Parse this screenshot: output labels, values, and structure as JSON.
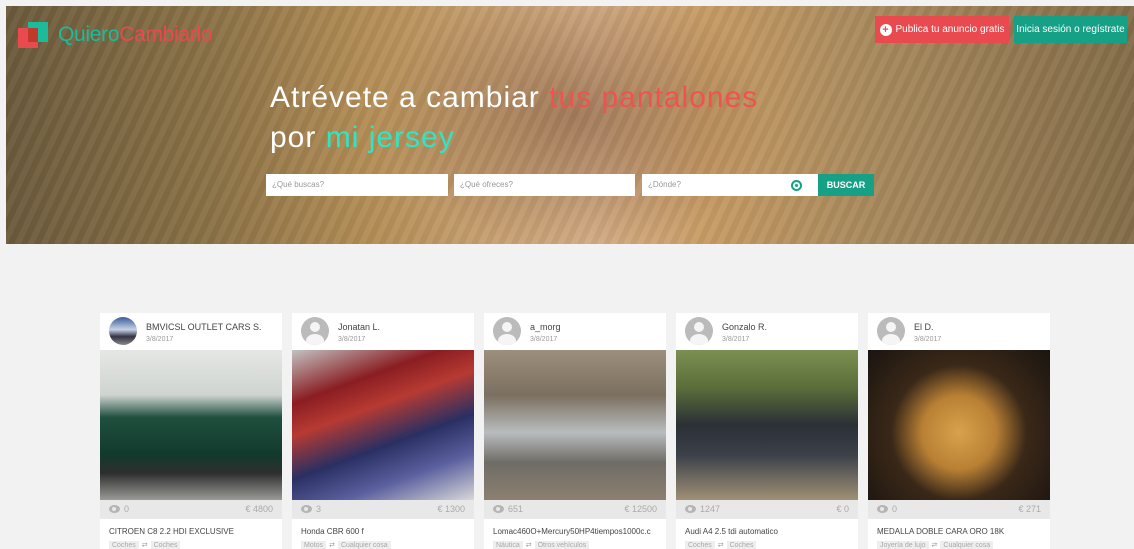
{
  "header": {
    "logo_part1": "Quiero",
    "logo_part2": "Cambiarlo",
    "publish_label": "Publica tu anuncio gratis",
    "login_label": "Inicia sesión o regístrate"
  },
  "hero": {
    "line1_prefix": "Atrévete a cambiar ",
    "line1_highlight": "tus pantalones",
    "line2_prefix": "por ",
    "line2_highlight": "mi jersey"
  },
  "search": {
    "what_placeholder": "¿Qué buscas?",
    "offer_placeholder": "¿Qué ofreces?",
    "where_placeholder": "¿Dónde?",
    "button_label": "BUSCAR"
  },
  "cards": [
    {
      "user": "BMVICSL OUTLET CARS S.",
      "date": "3/8/2017",
      "views": "0",
      "price": "€ 4800",
      "title": "CITROEN C8 2.2 HDI EXCLUSIVE",
      "tag_from": "Coches",
      "tag_to": "Coches"
    },
    {
      "user": "Jonatan L.",
      "date": "3/8/2017",
      "views": "3",
      "price": "€ 1300",
      "title": "Honda CBR 600 f",
      "tag_from": "Motos",
      "tag_to": "Cualquier cosa"
    },
    {
      "user": "a_morg",
      "date": "3/8/2017",
      "views": "651",
      "price": "€ 12500",
      "title": "Lomac460O+Mercury50HP4tiempos1000c.c",
      "tag_from": "Náutica",
      "tag_to": "Otros vehículos"
    },
    {
      "user": "Gonzalo R.",
      "date": "3/8/2017",
      "views": "1247",
      "price": "€ 0",
      "title": "Audi A4 2.5 tdi automatico",
      "tag_from": "Coches",
      "tag_to": "Coches"
    },
    {
      "user": "El D.",
      "date": "3/8/2017",
      "views": "0",
      "price": "€ 271",
      "title": "MEDALLA DOBLE CARA ORO 18K",
      "tag_from": "Joyería de lujo",
      "tag_to": "Cualquier cosa"
    }
  ]
}
